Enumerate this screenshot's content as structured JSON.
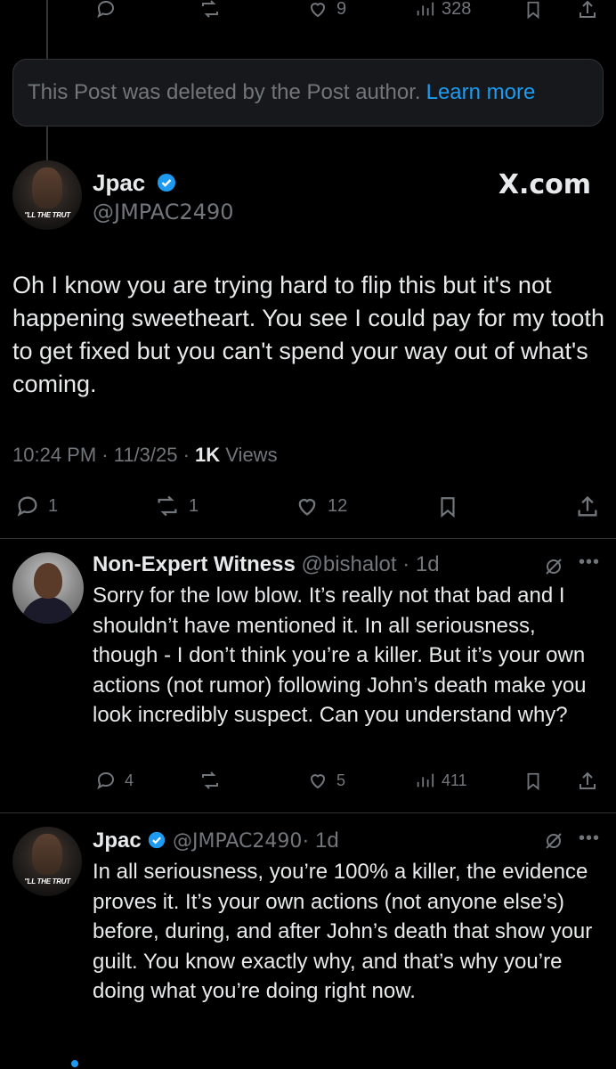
{
  "top_actions": {
    "likes": "9",
    "views": "328"
  },
  "deleted_notice": {
    "text": "This Post was deleted by the Post author.",
    "link": "Learn more"
  },
  "main_post": {
    "author_name": "Jpac",
    "author_handle": "@JMPAC2490",
    "avatar_caption": "TELL THE TRUTH",
    "brand": "X.com",
    "text": "Oh I know you are trying hard to flip this but it's not happening sweetheart. You see I could pay for my tooth to get fixed but you can't spend your way out of what's coming.",
    "time": "10:24 PM · 11/3/25 · ",
    "views_count": "1K",
    "views_label": " Views",
    "replies": "1",
    "reposts": "1",
    "likes": "12"
  },
  "reply1": {
    "author_name": "Non-Expert Witness",
    "author_handle": "@bishalot",
    "age": "· 1d",
    "text": "Sorry for the low blow. It’s really not that bad and I shouldn’t have mentioned it. In all seriousness, though - I don’t think you’re a killer. But it’s your own actions (not rumor) following John’s death make you look incredibly suspect. Can you understand why?",
    "replies": "4",
    "likes": "5",
    "views": "411"
  },
  "reply2": {
    "author_name": "Jpac",
    "author_handle": "@JMPAC2490",
    "age": "· 1d",
    "avatar_caption": "TELL THE TRUTH",
    "text": "In all seriousness, you’re 100% a killer, the evidence proves it. It’s your own actions (not anyone else’s) before, during, and after John’s death that show your guilt. You know exactly why, and that’s why you’re doing what you’re doing right now."
  },
  "colors": {
    "background": "#000000",
    "text": "#e7e9ea",
    "muted": "#71767b",
    "accent": "#1d9bf0",
    "border": "#2f3336"
  }
}
